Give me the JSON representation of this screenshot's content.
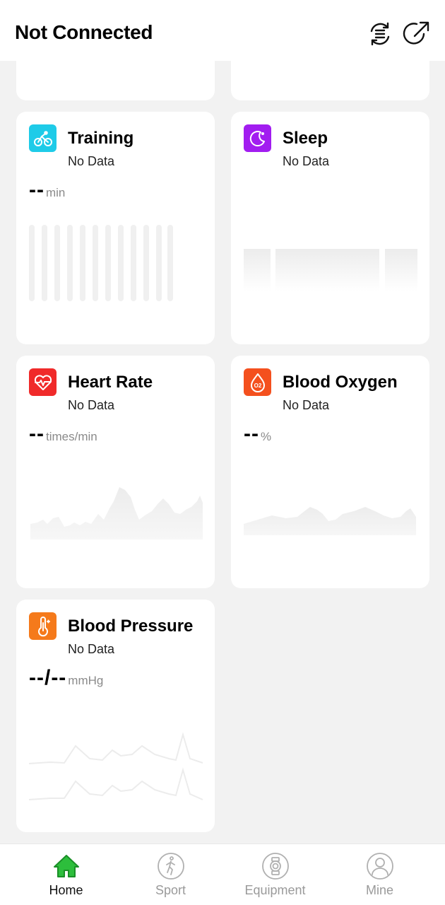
{
  "header": {
    "title": "Not Connected",
    "icons": [
      "sync-icon",
      "share-icon"
    ]
  },
  "cards": {
    "training": {
      "title": "Training",
      "status": "No Data",
      "value": "--",
      "unit": "min",
      "icon": "bicycle-icon",
      "color": "#1ecbe8"
    },
    "sleep": {
      "title": "Sleep",
      "status": "No Data",
      "icon": "moon-icon",
      "color": "#a21df0"
    },
    "heart_rate": {
      "title": "Heart Rate",
      "status": "No Data",
      "value": "--",
      "unit": "times/min",
      "icon": "heart-icon",
      "color": "#f02a2a"
    },
    "blood_oxygen": {
      "title": "Blood Oxygen",
      "status": "No Data",
      "value": "--",
      "unit": "%",
      "icon": "oxygen-drop-icon",
      "icon_text": "O2",
      "color": "#f4501e"
    },
    "blood_pressure": {
      "title": "Blood Pressure",
      "status": "No Data",
      "value": "--/--",
      "unit": "mmHg",
      "icon": "thermometer-icon",
      "color": "#f57a1b"
    }
  },
  "tabs": [
    {
      "label": "Home",
      "icon": "home-icon",
      "active": true,
      "color": "#2dbe3c"
    },
    {
      "label": "Sport",
      "icon": "runner-icon",
      "active": false
    },
    {
      "label": "Equipment",
      "icon": "watch-icon",
      "active": false
    },
    {
      "label": "Mine",
      "icon": "user-icon",
      "active": false
    }
  ]
}
